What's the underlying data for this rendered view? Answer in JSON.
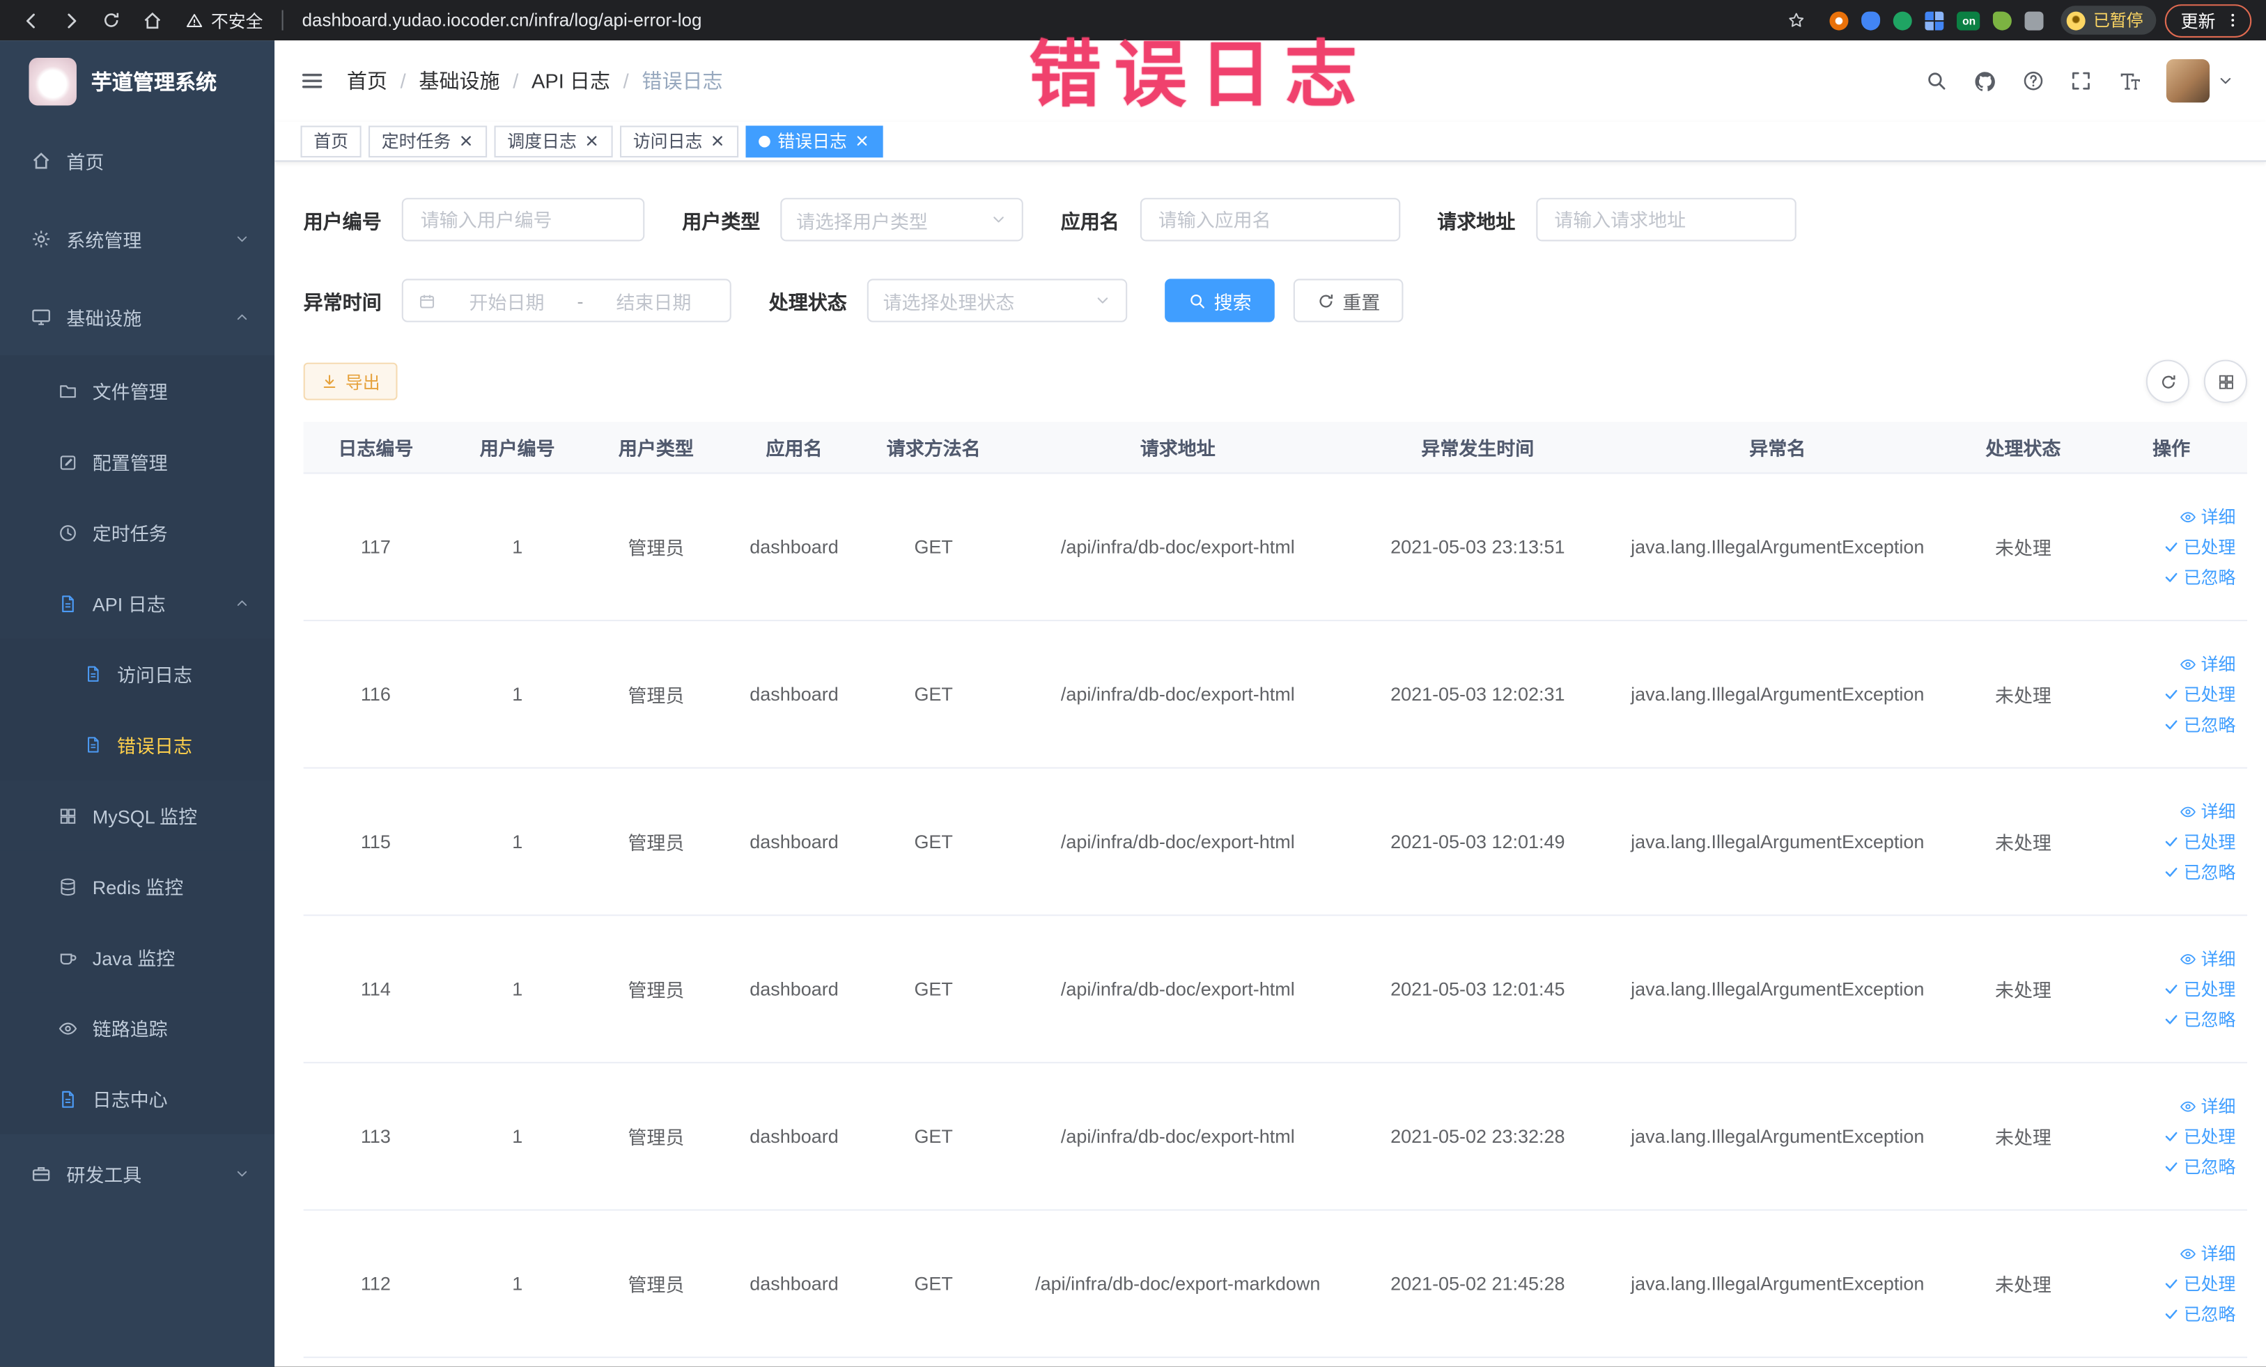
{
  "colors": {
    "accent": "#409eff",
    "sidebar_bg": "#304156",
    "active_menu_text": "#ffd04b",
    "warning_button": "#e6a23c",
    "annotation": "#f03e6a",
    "chrome_bg": "#202124"
  },
  "browser": {
    "security_label": "不安全",
    "url": "dashboard.yudao.iocoder.cn/infra/log/api-error-log",
    "extension_on_badge": "on",
    "paused_badge": "已暂停",
    "update_button": "更新"
  },
  "annotation": {
    "text": "错误日志"
  },
  "sidebar": {
    "logo_title": "芋道管理系统",
    "items": [
      {
        "label": "首页"
      },
      {
        "label": "系统管理"
      },
      {
        "label": "基础设施"
      },
      {
        "label": "文件管理"
      },
      {
        "label": "配置管理"
      },
      {
        "label": "定时任务"
      },
      {
        "label": "API 日志"
      },
      {
        "label": "访问日志"
      },
      {
        "label": "错误日志",
        "active": true
      },
      {
        "label": "MySQL 监控"
      },
      {
        "label": "Redis 监控"
      },
      {
        "label": "Java 监控"
      },
      {
        "label": "链路追踪"
      },
      {
        "label": "日志中心"
      },
      {
        "label": "研发工具"
      }
    ]
  },
  "breadcrumb": {
    "items": [
      "首页",
      "基础设施",
      "API 日志",
      "错误日志"
    ]
  },
  "tabs": [
    {
      "label": "首页",
      "closable": false,
      "active": false
    },
    {
      "label": "定时任务",
      "closable": true,
      "active": false
    },
    {
      "label": "调度日志",
      "closable": true,
      "active": false
    },
    {
      "label": "访问日志",
      "closable": true,
      "active": false
    },
    {
      "label": "错误日志",
      "closable": true,
      "active": true
    }
  ],
  "filters": {
    "user_id": {
      "label": "用户编号",
      "placeholder": "请输入用户编号"
    },
    "user_type": {
      "label": "用户类型",
      "placeholder": "请选择用户类型"
    },
    "app_name": {
      "label": "应用名",
      "placeholder": "请输入应用名"
    },
    "request_url": {
      "label": "请求地址",
      "placeholder": "请输入请求地址"
    },
    "exception_time": {
      "label": "异常时间",
      "start_placeholder": "开始日期",
      "separator": "-",
      "end_placeholder": "结束日期"
    },
    "process_status": {
      "label": "处理状态",
      "placeholder": "请选择处理状态"
    },
    "search_button": "搜索",
    "reset_button": "重置"
  },
  "toolbar": {
    "export_button": "导出"
  },
  "table": {
    "columns": [
      "日志编号",
      "用户编号",
      "用户类型",
      "应用名",
      "请求方法名",
      "请求地址",
      "异常发生时间",
      "异常名",
      "处理状态",
      "操作"
    ],
    "actions": {
      "detail": "详细",
      "processed": "已处理",
      "ignored": "已忽略"
    },
    "rows": [
      {
        "id": "117",
        "user_id": "1",
        "user_type": "管理员",
        "app": "dashboard",
        "method": "GET",
        "url": "/api/infra/db-doc/export-html",
        "time": "2021-05-03 23:13:51",
        "exception": "java.lang.IllegalArgumentException",
        "status": "未处理"
      },
      {
        "id": "116",
        "user_id": "1",
        "user_type": "管理员",
        "app": "dashboard",
        "method": "GET",
        "url": "/api/infra/db-doc/export-html",
        "time": "2021-05-03 12:02:31",
        "exception": "java.lang.IllegalArgumentException",
        "status": "未处理"
      },
      {
        "id": "115",
        "user_id": "1",
        "user_type": "管理员",
        "app": "dashboard",
        "method": "GET",
        "url": "/api/infra/db-doc/export-html",
        "time": "2021-05-03 12:01:49",
        "exception": "java.lang.IllegalArgumentException",
        "status": "未处理"
      },
      {
        "id": "114",
        "user_id": "1",
        "user_type": "管理员",
        "app": "dashboard",
        "method": "GET",
        "url": "/api/infra/db-doc/export-html",
        "time": "2021-05-03 12:01:45",
        "exception": "java.lang.IllegalArgumentException",
        "status": "未处理"
      },
      {
        "id": "113",
        "user_id": "1",
        "user_type": "管理员",
        "app": "dashboard",
        "method": "GET",
        "url": "/api/infra/db-doc/export-html",
        "time": "2021-05-02 23:32:28",
        "exception": "java.lang.IllegalArgumentException",
        "status": "未处理"
      },
      {
        "id": "112",
        "user_id": "1",
        "user_type": "管理员",
        "app": "dashboard",
        "method": "GET",
        "url": "/api/infra/db-doc/export-markdown",
        "time": "2021-05-02 21:45:28",
        "exception": "java.lang.IllegalArgumentException",
        "status": "未处理"
      }
    ]
  },
  "icons": [
    "back-icon",
    "forward-icon",
    "reload-icon",
    "home-icon",
    "warning-icon",
    "star-icon",
    "kebab-menu-icon",
    "hamburger-icon",
    "search-icon",
    "github-icon",
    "help-icon",
    "fullscreen-icon",
    "font-size-icon",
    "caret-down-icon",
    "calendar-icon",
    "download-icon",
    "eye-icon",
    "check-icon",
    "gear-icon",
    "grid-icon",
    "document-icon",
    "clock-icon",
    "monitor-icon",
    "folder-icon",
    "edit-icon",
    "database-icon",
    "coffee-icon",
    "toolbox-icon",
    "close-icon"
  ]
}
